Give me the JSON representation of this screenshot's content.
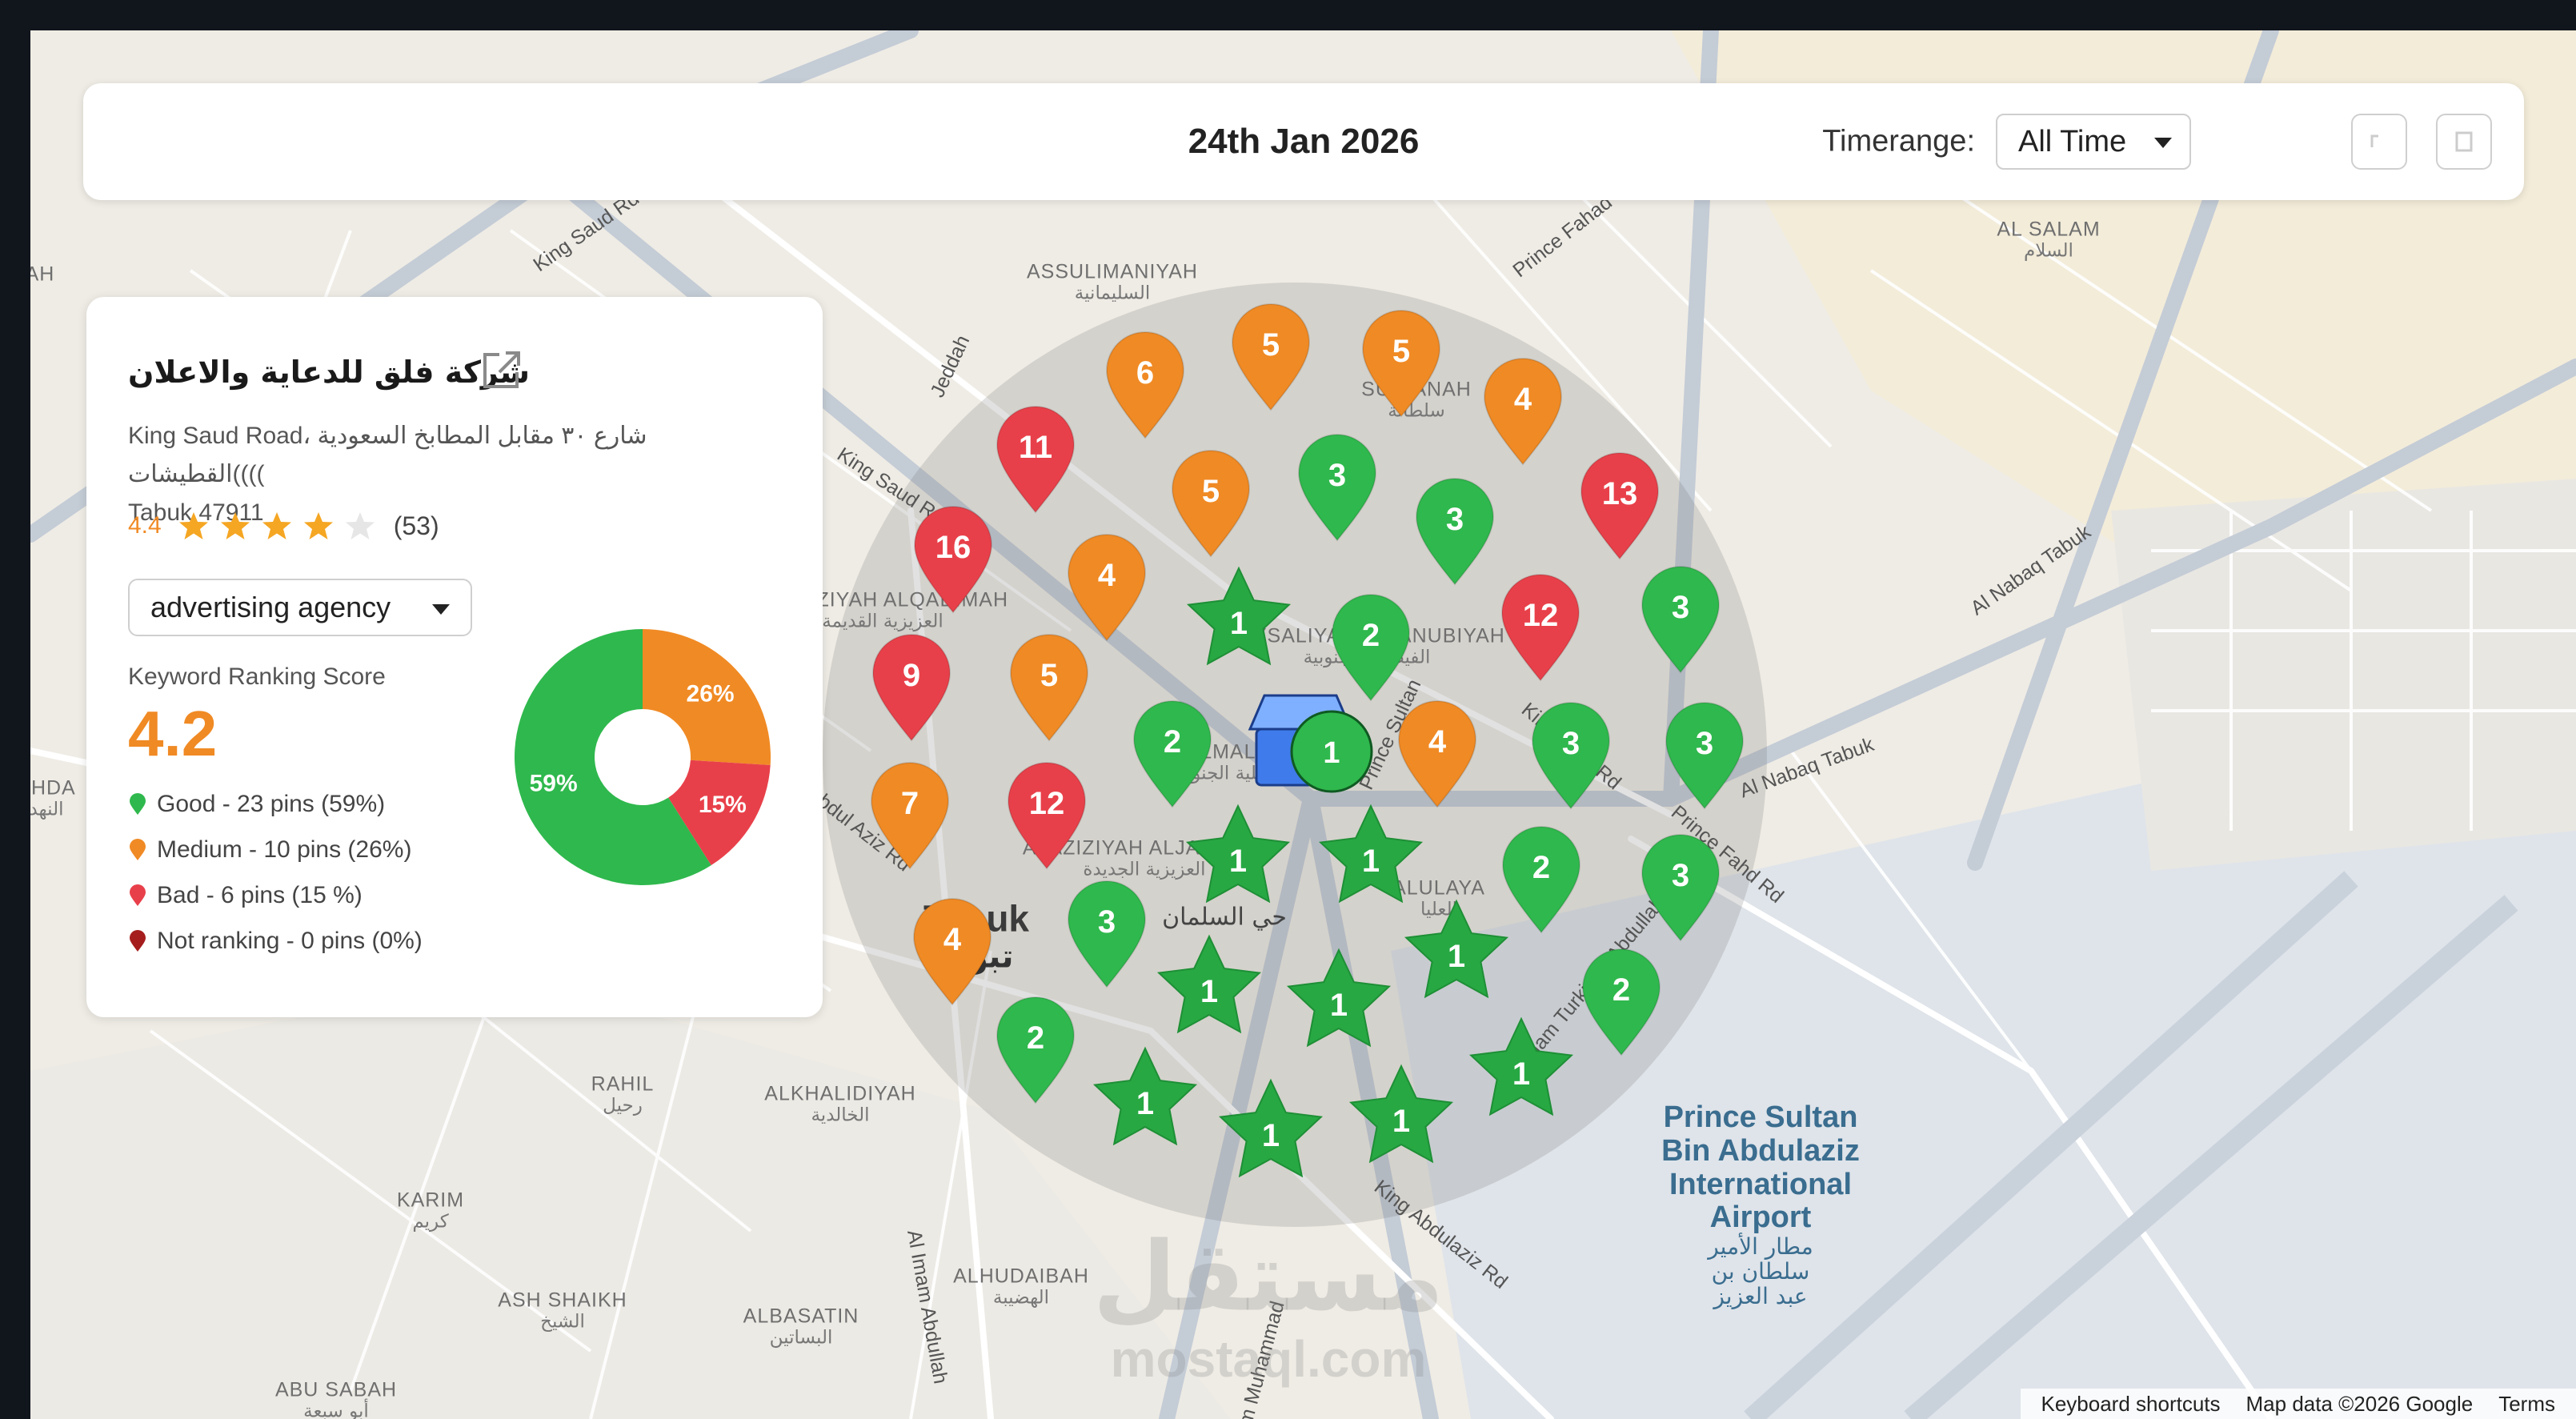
{
  "header": {
    "date": "24th Jan 2026",
    "timerange_label": "Timerange:",
    "timerange_value": "All Time"
  },
  "business": {
    "name": "شركة فلق للدعاية والاعلان",
    "address_line1": "King Saud Road، شارع ٣٠ مقابل المطابخ السعودية ))القطيشات((",
    "address_line2": "Tabuk 47911",
    "rating": "4.4",
    "rating_stars": 4,
    "review_count": "(53)",
    "category": "advertising agency",
    "score_label": "Keyword Ranking Score",
    "score_value": "4.2",
    "legend": [
      {
        "label": "Good -  23 pins (59%)",
        "color": "#2fb84d"
      },
      {
        "label": "Medium -  10  pins (26%)",
        "color": "#f08a24"
      },
      {
        "label": "Bad -  6 pins (15 %)",
        "color": "#e8404a"
      },
      {
        "label": "Not ranking -  0 pins (0%)",
        "color": "#a51d1d"
      }
    ]
  },
  "chart_data": {
    "type": "pie",
    "categories": [
      "Good",
      "Medium",
      "Bad"
    ],
    "values": [
      59,
      26,
      15
    ],
    "labels": [
      "59%",
      "26%",
      "15%"
    ],
    "colors": [
      "#2fb84d",
      "#f08a24",
      "#e8404a"
    ]
  },
  "map": {
    "labels": [
      {
        "text": "ASSULIMANIYAH",
        "ar": "السليمانية"
      },
      {
        "text": "SULTANAH",
        "ar": "سلطانة"
      },
      {
        "text": "AL SALAM",
        "ar": "السلام"
      },
      {
        "text": "ALAZIZIYAH ALQADIMAH",
        "ar": "العزيزية القديمة"
      },
      {
        "text": "FAYSALIYAH ALJANUBIYAH",
        "ar": "الفيصلية الجنوبية"
      },
      {
        "text": "ALMALAZ",
        "ar": "الفيصلية الجنوبية"
      },
      {
        "text": "ALAZIZIYAH ALJADIDAH",
        "ar": "العزيزية الجديدة"
      },
      {
        "text": "ALULAYA",
        "ar": "العليا"
      },
      {
        "text": "RAHIL",
        "ar": "رحيل"
      },
      {
        "text": "ALKHALIDIYAH",
        "ar": "الخالدية"
      },
      {
        "text": "KARIM",
        "ar": "كريم"
      },
      {
        "text": "ASH SHAIKH",
        "ar": "الشيخ"
      },
      {
        "text": "ALBASATIN",
        "ar": "البساتين"
      },
      {
        "text": "ALHUDAIBAH",
        "ar": "الهضيبة"
      },
      {
        "text": "ABU SABAH",
        "ar": "أبو سبعة"
      },
      {
        "text": "AHDA",
        "ar": "النهد"
      },
      {
        "text": "AH",
        "ar": ""
      }
    ],
    "city": {
      "text": "Tabuk",
      "ar": "تبوك"
    },
    "district_ar": "حي السلمان",
    "airport": {
      "line1": "Prince Sultan",
      "line2": "Bin Abdulaziz",
      "line3": "International",
      "line4": "Airport",
      "ar1": "مطار الأمير",
      "ar2": "سلطان بن",
      "ar3": "عبد العزيز"
    },
    "roads": [
      "King Saud Rd",
      "King Saud Rd",
      "Jeddah",
      "Prince Fahad",
      "Al Nabaq Tabuk",
      "Al Nabaq Tabuk",
      "King Fahd Rd",
      "Prince Sultan",
      "Al Imam Turki Ibn Abdullah Rd",
      "King Abdulaziz Rd",
      "Al Imam Abdullah",
      "Abdul Aziz Rd",
      "Prince Fahd Rd",
      "Al Imam Muhammad"
    ],
    "pins": [
      {
        "rank": "6",
        "status": "medium"
      },
      {
        "rank": "5",
        "status": "medium"
      },
      {
        "rank": "5",
        "status": "medium"
      },
      {
        "rank": "4",
        "status": "medium"
      },
      {
        "rank": "11",
        "status": "bad"
      },
      {
        "rank": "5",
        "status": "medium"
      },
      {
        "rank": "3",
        "status": "good"
      },
      {
        "rank": "3",
        "status": "good"
      },
      {
        "rank": "13",
        "status": "bad"
      },
      {
        "rank": "16",
        "status": "bad"
      },
      {
        "rank": "4",
        "status": "medium"
      },
      {
        "rank": "1",
        "status": "top"
      },
      {
        "rank": "2",
        "status": "good"
      },
      {
        "rank": "12",
        "status": "bad"
      },
      {
        "rank": "3",
        "status": "good"
      },
      {
        "rank": "9",
        "status": "bad"
      },
      {
        "rank": "5",
        "status": "medium"
      },
      {
        "rank": "2",
        "status": "good"
      },
      {
        "rank": "4",
        "status": "medium"
      },
      {
        "rank": "3",
        "status": "good"
      },
      {
        "rank": "3",
        "status": "good"
      },
      {
        "rank": "7",
        "status": "medium"
      },
      {
        "rank": "12",
        "status": "bad"
      },
      {
        "rank": "1",
        "status": "top"
      },
      {
        "rank": "1",
        "status": "top"
      },
      {
        "rank": "2",
        "status": "good"
      },
      {
        "rank": "3",
        "status": "good"
      },
      {
        "rank": "4",
        "status": "medium"
      },
      {
        "rank": "3",
        "status": "good"
      },
      {
        "rank": "1",
        "status": "top"
      },
      {
        "rank": "1",
        "status": "top"
      },
      {
        "rank": "1",
        "status": "top"
      },
      {
        "rank": "2",
        "status": "good"
      },
      {
        "rank": "2",
        "status": "good"
      },
      {
        "rank": "1",
        "status": "top"
      },
      {
        "rank": "1",
        "status": "top"
      },
      {
        "rank": "1",
        "status": "top"
      },
      {
        "rank": "1",
        "status": "top"
      }
    ],
    "center_rank": "1",
    "pin_colors": {
      "good": "#2fb84d",
      "medium": "#f08a24",
      "bad": "#e8404a",
      "top": "#27a843"
    },
    "watermark": {
      "ar": "مستقل",
      "en": "mostaql.com"
    }
  },
  "attribution": {
    "shortcuts": "Keyboard shortcuts",
    "map_data": "Map data ©2026 Google",
    "terms": "Terms"
  },
  "icons": [
    "external-link-icon",
    "star-icon",
    "caret-down-icon",
    "store-icon",
    "map-pin-icon"
  ]
}
